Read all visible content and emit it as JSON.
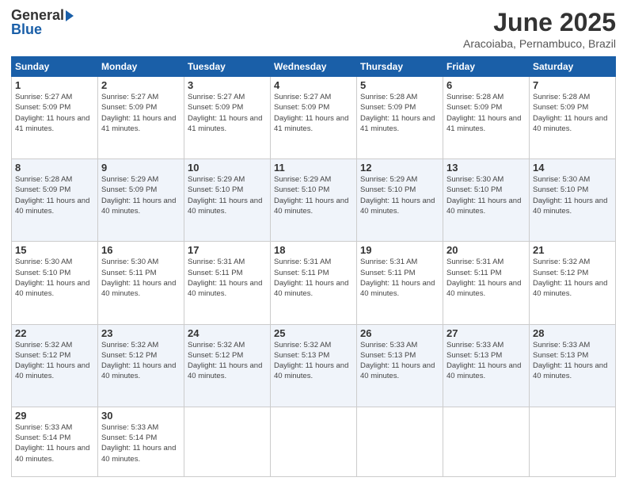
{
  "header": {
    "logo_general": "General",
    "logo_blue": "Blue",
    "title": "June 2025",
    "subtitle": "Aracoiaba, Pernambuco, Brazil"
  },
  "weekdays": [
    "Sunday",
    "Monday",
    "Tuesday",
    "Wednesday",
    "Thursday",
    "Friday",
    "Saturday"
  ],
  "weeks": [
    {
      "days": [
        {
          "num": "1",
          "sunrise": "5:27 AM",
          "sunset": "5:09 PM",
          "daylight": "11 hours and 41 minutes."
        },
        {
          "num": "2",
          "sunrise": "5:27 AM",
          "sunset": "5:09 PM",
          "daylight": "11 hours and 41 minutes."
        },
        {
          "num": "3",
          "sunrise": "5:27 AM",
          "sunset": "5:09 PM",
          "daylight": "11 hours and 41 minutes."
        },
        {
          "num": "4",
          "sunrise": "5:27 AM",
          "sunset": "5:09 PM",
          "daylight": "11 hours and 41 minutes."
        },
        {
          "num": "5",
          "sunrise": "5:28 AM",
          "sunset": "5:09 PM",
          "daylight": "11 hours and 41 minutes."
        },
        {
          "num": "6",
          "sunrise": "5:28 AM",
          "sunset": "5:09 PM",
          "daylight": "11 hours and 41 minutes."
        },
        {
          "num": "7",
          "sunrise": "5:28 AM",
          "sunset": "5:09 PM",
          "daylight": "11 hours and 40 minutes."
        }
      ]
    },
    {
      "days": [
        {
          "num": "8",
          "sunrise": "5:28 AM",
          "sunset": "5:09 PM",
          "daylight": "11 hours and 40 minutes."
        },
        {
          "num": "9",
          "sunrise": "5:29 AM",
          "sunset": "5:09 PM",
          "daylight": "11 hours and 40 minutes."
        },
        {
          "num": "10",
          "sunrise": "5:29 AM",
          "sunset": "5:10 PM",
          "daylight": "11 hours and 40 minutes."
        },
        {
          "num": "11",
          "sunrise": "5:29 AM",
          "sunset": "5:10 PM",
          "daylight": "11 hours and 40 minutes."
        },
        {
          "num": "12",
          "sunrise": "5:29 AM",
          "sunset": "5:10 PM",
          "daylight": "11 hours and 40 minutes."
        },
        {
          "num": "13",
          "sunrise": "5:30 AM",
          "sunset": "5:10 PM",
          "daylight": "11 hours and 40 minutes."
        },
        {
          "num": "14",
          "sunrise": "5:30 AM",
          "sunset": "5:10 PM",
          "daylight": "11 hours and 40 minutes."
        }
      ]
    },
    {
      "days": [
        {
          "num": "15",
          "sunrise": "5:30 AM",
          "sunset": "5:10 PM",
          "daylight": "11 hours and 40 minutes."
        },
        {
          "num": "16",
          "sunrise": "5:30 AM",
          "sunset": "5:11 PM",
          "daylight": "11 hours and 40 minutes."
        },
        {
          "num": "17",
          "sunrise": "5:31 AM",
          "sunset": "5:11 PM",
          "daylight": "11 hours and 40 minutes."
        },
        {
          "num": "18",
          "sunrise": "5:31 AM",
          "sunset": "5:11 PM",
          "daylight": "11 hours and 40 minutes."
        },
        {
          "num": "19",
          "sunrise": "5:31 AM",
          "sunset": "5:11 PM",
          "daylight": "11 hours and 40 minutes."
        },
        {
          "num": "20",
          "sunrise": "5:31 AM",
          "sunset": "5:11 PM",
          "daylight": "11 hours and 40 minutes."
        },
        {
          "num": "21",
          "sunrise": "5:32 AM",
          "sunset": "5:12 PM",
          "daylight": "11 hours and 40 minutes."
        }
      ]
    },
    {
      "days": [
        {
          "num": "22",
          "sunrise": "5:32 AM",
          "sunset": "5:12 PM",
          "daylight": "11 hours and 40 minutes."
        },
        {
          "num": "23",
          "sunrise": "5:32 AM",
          "sunset": "5:12 PM",
          "daylight": "11 hours and 40 minutes."
        },
        {
          "num": "24",
          "sunrise": "5:32 AM",
          "sunset": "5:12 PM",
          "daylight": "11 hours and 40 minutes."
        },
        {
          "num": "25",
          "sunrise": "5:32 AM",
          "sunset": "5:13 PM",
          "daylight": "11 hours and 40 minutes."
        },
        {
          "num": "26",
          "sunrise": "5:33 AM",
          "sunset": "5:13 PM",
          "daylight": "11 hours and 40 minutes."
        },
        {
          "num": "27",
          "sunrise": "5:33 AM",
          "sunset": "5:13 PM",
          "daylight": "11 hours and 40 minutes."
        },
        {
          "num": "28",
          "sunrise": "5:33 AM",
          "sunset": "5:13 PM",
          "daylight": "11 hours and 40 minutes."
        }
      ]
    },
    {
      "days": [
        {
          "num": "29",
          "sunrise": "5:33 AM",
          "sunset": "5:14 PM",
          "daylight": "11 hours and 40 minutes."
        },
        {
          "num": "30",
          "sunrise": "5:33 AM",
          "sunset": "5:14 PM",
          "daylight": "11 hours and 40 minutes."
        },
        null,
        null,
        null,
        null,
        null
      ]
    }
  ]
}
